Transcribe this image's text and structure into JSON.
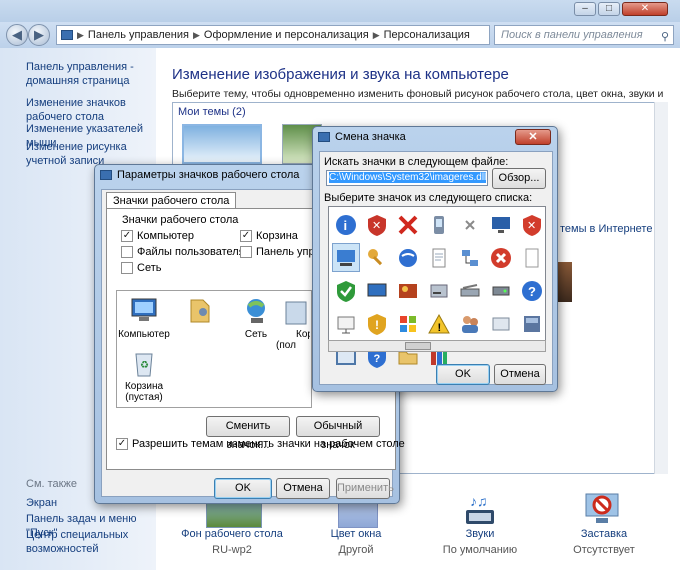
{
  "window": {
    "title_buttons": [
      "–",
      "□",
      "✕"
    ]
  },
  "nav": {
    "back_icon": "back-arrow-icon",
    "forward_icon": "forward-arrow-icon",
    "breadcrumb": [
      "Панель управления",
      "Оформление и персонализация",
      "Персонализация"
    ],
    "search_placeholder": "Поиск в панели управления"
  },
  "left_pane": {
    "links": [
      "Панель управления - домашняя страница",
      "Изменение значков рабочего стола",
      "Изменение указателей мыши",
      "Изменение рисунка учетной записи"
    ],
    "see_also_heading": "См. также",
    "see_also": [
      "Экран",
      "Панель задач и меню \"Пуск\"",
      "Центр специальных возможностей"
    ]
  },
  "main": {
    "title": "Изменение изображения и звука на компьютере",
    "subtitle": "Выберите тему, чтобы одновременно изменить фоновый рисунок рабочего стола, цвет окна, звуки и заставку.",
    "my_themes": "Мои темы (2)",
    "online_link": "темы в Интернете",
    "footer": [
      {
        "label": "Фон рабочего стола",
        "value": "RU-wp2"
      },
      {
        "label": "Цвет окна",
        "value": "Другой"
      },
      {
        "label": "Звуки",
        "value": "По умолчанию"
      },
      {
        "label": "Заставка",
        "value": "Отсутствует"
      }
    ]
  },
  "desktop_icons_dialog": {
    "title": "Параметры значков рабочего стола",
    "tab": "Значки рабочего стола",
    "group_label": "Значки рабочего стола",
    "checkboxes": [
      {
        "label": "Компьютер",
        "checked": true
      },
      {
        "label": "Корзина",
        "checked": true
      },
      {
        "label": "Файлы пользователя",
        "checked": false
      },
      {
        "label": "Панель управле",
        "checked": false
      },
      {
        "label": "Сеть",
        "checked": false
      }
    ],
    "icons": [
      "Компьютер",
      "",
      "Сеть",
      "Корз (пол",
      "Корзина (пустая)"
    ],
    "change_icon_btn": "Сменить значок...",
    "default_btn": "Обычный значок",
    "allow_themes": "Разрешить темам изменять значки на рабочем столе",
    "ok": "OK",
    "cancel": "Отмена",
    "apply": "Применить"
  },
  "change_icon_dialog": {
    "title": "Смена значка",
    "file_label": "Искать значки в следующем файле:",
    "file_value": "C:\\Windows\\System32\\imageres.dll",
    "browse": "Обзор...",
    "list_label": "Выберите значок из следующего списка:",
    "icons": [
      "info-icon",
      "shield-red-icon",
      "x-icon",
      "phone-icon",
      "cross-small-icon",
      "monitor-icon",
      "shield-x-icon",
      "monitor-selected-icon",
      "key-icon",
      "globe-icon",
      "document-icon",
      "network-icon",
      "error-icon",
      "blank-page-icon",
      "check-shield-icon",
      "screen-icon",
      "photo-icon",
      "drive-icon",
      "scanner-icon",
      "hard-drive-icon",
      "question-icon",
      "projector-icon",
      "warning-shield-icon",
      "windows-flag-icon",
      "warning-icon",
      "users-icon",
      "card-icon",
      "cabinet-icon",
      "picture-frame-icon",
      "help-shield-icon",
      "folder-icon",
      "books-icon"
    ],
    "ok": "OK",
    "cancel": "Отмена"
  }
}
